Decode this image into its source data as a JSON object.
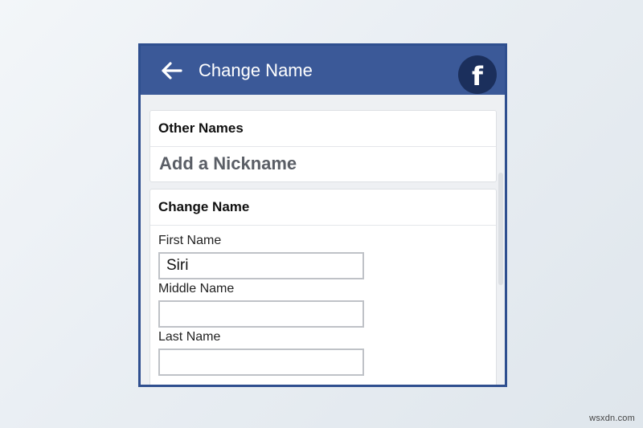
{
  "header": {
    "title": "Change Name"
  },
  "other_names": {
    "heading": "Other Names",
    "nickname_link": "Add a Nickname"
  },
  "change_name": {
    "heading": "Change Name",
    "first_name": {
      "label": "First Name",
      "value": "Siri"
    },
    "middle_name": {
      "label": "Middle Name",
      "value": ""
    },
    "last_name": {
      "label": "Last Name",
      "value": ""
    }
  },
  "watermark": "wsxdn.com",
  "colors": {
    "topbar": "#3b5998",
    "frame_border": "#2f4f8f",
    "logo_bg": "#1b2f5c"
  },
  "icons": {
    "back": "arrow-left-icon",
    "brand": "facebook-logo"
  }
}
